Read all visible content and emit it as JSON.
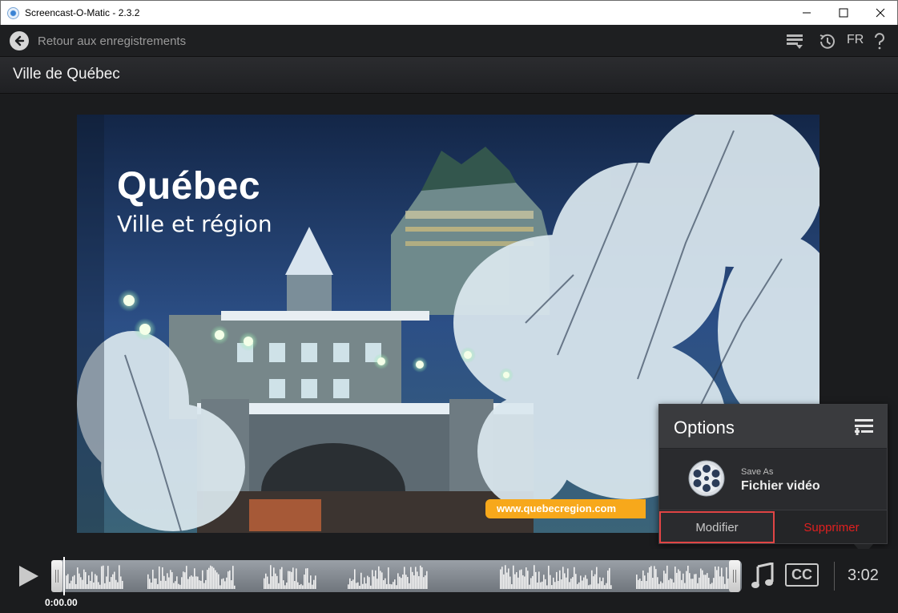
{
  "window": {
    "title": "Screencast-O-Matic - 2.3.2"
  },
  "toolbar": {
    "back_label": "Retour aux enregistrements",
    "language": "FR",
    "icons": [
      "queue-icon",
      "history-icon",
      "help-icon"
    ]
  },
  "recording": {
    "title": "Ville de Québec"
  },
  "video": {
    "headline": "Québec",
    "subheadline": "Ville et région",
    "url_banner": "www.quebecregion.com"
  },
  "options": {
    "title": "Options",
    "save_as_label": "Save As",
    "save_as_value": "Fichier vidéo",
    "modify_label": "Modifier",
    "delete_label": "Supprimer"
  },
  "player": {
    "current_time": "0:00.00",
    "duration": "3:02",
    "cc_label": "CC"
  },
  "colors": {
    "accent_red": "#e04545",
    "delete_red": "#e02020",
    "url_orange": "#f7a81b"
  }
}
